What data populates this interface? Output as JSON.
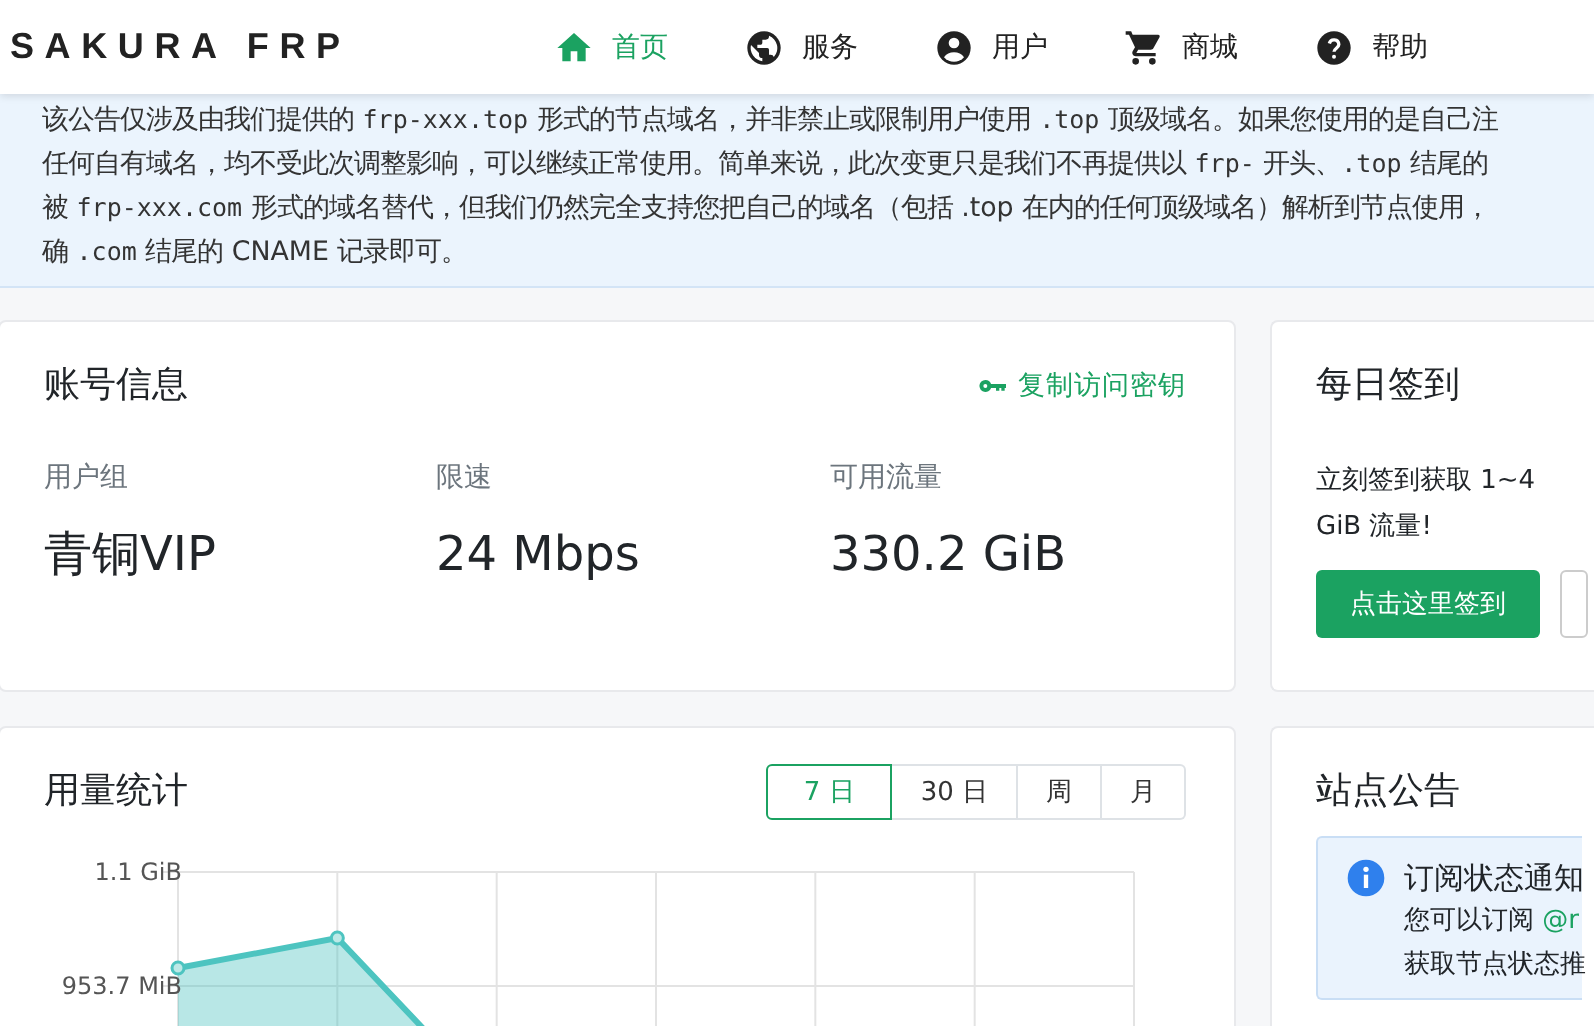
{
  "header": {
    "logo": "SAKURA FRP",
    "nav": [
      {
        "label": "首页",
        "selected": true
      },
      {
        "label": "服务",
        "selected": false
      },
      {
        "label": "用户",
        "selected": false
      },
      {
        "label": "商城",
        "selected": false
      },
      {
        "label": "帮助",
        "selected": false
      }
    ]
  },
  "notice": {
    "lines": [
      [
        {
          "text": "该公告仅涉及由我们提供的 ",
          "kind": "text"
        },
        {
          "text": "frp-xxx.top",
          "kind": "code"
        },
        {
          "text": " 形式的节点域名，并非禁止或限制用户使用 ",
          "kind": "text"
        },
        {
          "text": ".top",
          "kind": "code"
        },
        {
          "text": " 顶级域名。如果您使用的是自己注",
          "kind": "text"
        }
      ],
      [
        {
          "text": "任何自有域名，均不受此次调整影响，可以继续正常使用。简单来说，此次变更只是我们不再提供以 ",
          "kind": "text"
        },
        {
          "text": "frp-",
          "kind": "code"
        },
        {
          "text": " 开头、",
          "kind": "text"
        },
        {
          "text": ".top",
          "kind": "code"
        },
        {
          "text": " 结尾的",
          "kind": "text"
        }
      ],
      [
        {
          "text": "被 ",
          "kind": "text"
        },
        {
          "text": "frp-xxx.com",
          "kind": "code"
        },
        {
          "text": " 形式的域名替代，但我们仍然完全支持您把自己的域名（包括 .top 在内的任何顶级域名）解析到节点使用，",
          "kind": "text"
        }
      ],
      [
        {
          "text": "确 ",
          "kind": "text"
        },
        {
          "text": ".com",
          "kind": "code"
        },
        {
          "text": " 结尾的 CNAME 记录即可。",
          "kind": "text"
        }
      ]
    ]
  },
  "account": {
    "title": "账号信息",
    "action": "复制访问密钥",
    "stats": [
      {
        "label": "用户组",
        "value": "青铜VIP"
      },
      {
        "label": "限速",
        "value": "24 Mbps"
      },
      {
        "label": "可用流量",
        "value": "330.2 GiB"
      }
    ]
  },
  "checkin": {
    "title": "每日签到",
    "text": "立刻签到获取 1~4 GiB 流量!",
    "button": "点击这里签到"
  },
  "usage": {
    "title": "用量统计",
    "ranges": [
      {
        "label": "7 日",
        "selected": true
      },
      {
        "label": "30 日",
        "selected": false
      },
      {
        "label": "周",
        "selected": false
      },
      {
        "label": "月",
        "selected": false
      }
    ],
    "axis_labels": [
      "1.1 GiB",
      "953.7 MiB"
    ]
  },
  "announcements": {
    "title": "站点公告",
    "alert": {
      "title": "订阅状态通知",
      "line_1": "您可以订阅 ",
      "link": "@r",
      "line_2": "获取节点状态推"
    }
  }
}
